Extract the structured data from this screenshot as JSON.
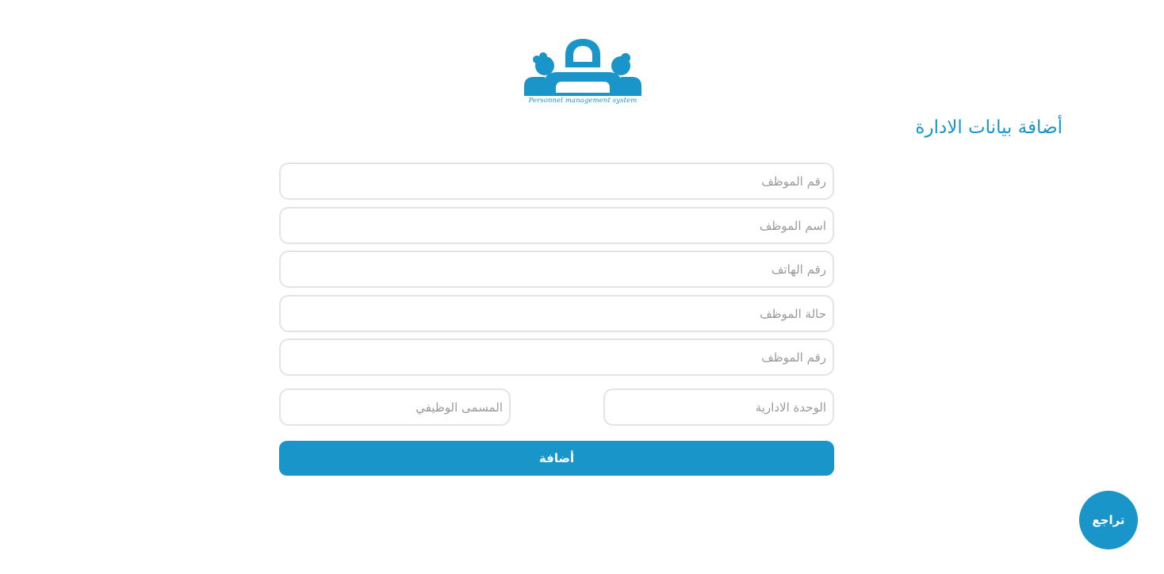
{
  "logo": {
    "caption": "Personnel management system",
    "icon": "people-group-icon",
    "color": "#1a95c9"
  },
  "page_title": "أضافة بيانات الادارة",
  "form": {
    "fields": [
      {
        "placeholder": "رقم الموظف",
        "value": ""
      },
      {
        "placeholder": "اسم الموظف",
        "value": ""
      },
      {
        "placeholder": "رقم الهاتف",
        "value": ""
      },
      {
        "placeholder": "حالة الموظف",
        "value": ""
      },
      {
        "placeholder": "رقم الموظف",
        "value": ""
      }
    ],
    "administrative_unit": {
      "placeholder": "الوحدة الادارية",
      "value": ""
    },
    "job_title": {
      "placeholder": "المسمى الوظيفي",
      "value": ""
    },
    "submit_label": "أضافة"
  },
  "back_button_label": "تراجع",
  "colors": {
    "accent": "#1a95c9",
    "field_border": "#e3e4e6",
    "placeholder": "#9a9a9a"
  }
}
